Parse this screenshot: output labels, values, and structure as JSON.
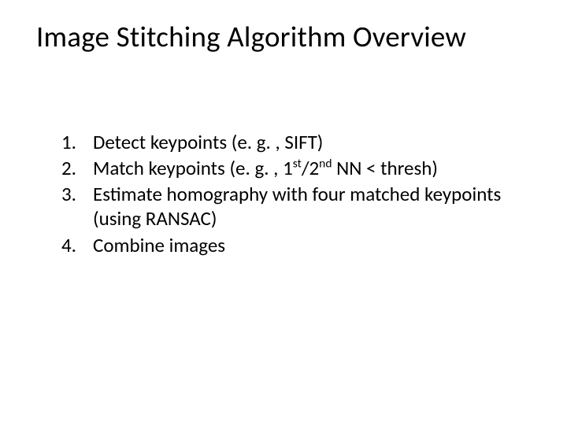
{
  "title": "Image Stitching Algorithm Overview",
  "steps": {
    "n1": "1.",
    "i1": "Detect keypoints (e. g. , SIFT)",
    "n2": "2.",
    "i2a": "Match keypoints (e. g. , 1",
    "i2sup1": "st",
    "i2mid": "/2",
    "i2sup2": "nd",
    "i2b": " NN < thresh)",
    "n3": "3.",
    "i3": "Estimate homography with four matched keypoints (using RANSAC)",
    "n4": "4.",
    "i4": "Combine images"
  }
}
